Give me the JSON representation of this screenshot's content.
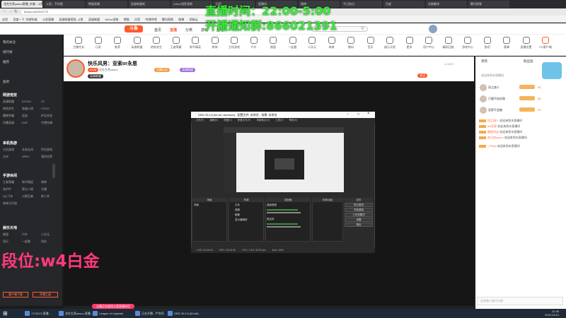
{
  "browser": {
    "tabs": [
      "沈先生养yasuo直播_外服 - 斗鱼直播",
      "斗鱼，手机版",
      "熊猫直播",
      "英雄联盟吧",
      "Arthur领养宠物",
      "抖音",
      "直播间",
      "微博",
      "今日热点",
      "百度",
      "谷歌翻译",
      "腾讯视频"
    ],
    "url": "douyu.com/101772",
    "bookmarks": [
      "应用",
      "百度一下, 你就知道",
      "斗鱼直播",
      "英雄联盟视频_斗鱼",
      "英雄联盟",
      "Arthur宠物",
      "熊猫",
      "抖音",
      "哔哩哔哩",
      "腾讯视频",
      "微博",
      "网易云"
    ]
  },
  "overlay": {
    "stream_time": "直播时间：22:00-5:00",
    "notice_group": "开播通知群:866021391",
    "rank_text": "段位:w4白金"
  },
  "site": {
    "logo": "斗鱼",
    "nav": [
      "首页",
      "直播",
      "分类",
      "游戏",
      "鱼吧"
    ],
    "search_placeholder": "搜索",
    "categories": [
      "主播任务",
      "订阅",
      "推荐",
      "英雄联盟",
      "绝地求生",
      "王者荣耀",
      "和平精英",
      "原神",
      "主机游戏",
      "户外",
      "颜值",
      "一起看",
      "二次元",
      "体育",
      "数码",
      "音乐",
      "娱乐天地",
      "更多",
      "用户中心",
      "精彩回放",
      "游戏中心",
      "鱼吧",
      "赛事",
      "直播设置",
      "PC客户端"
    ]
  },
  "sidebar": {
    "items": [
      "我的关注",
      "排行榜",
      "推荐",
      "鱼吧"
    ],
    "sections": [
      {
        "title": "网游竞技",
        "games": [
          "英雄联盟",
          "DOTA2",
          "CF",
          "绝地求生",
          "穿越火线",
          "CSGO",
          "魔兽争霸",
          "逆战",
          "炉石传说",
          "风暴英雄",
          "DNF",
          "守望先锋"
        ]
      },
      {
        "title": "单机热游",
        "games": [
          "主机游戏",
          "永劫无间",
          "怀旧游戏",
          "方舟",
          "APEX",
          "我的世界"
        ]
      },
      {
        "title": "手游休闲",
        "games": [
          "王者荣耀",
          "和平精英",
          "原神",
          "金铲铲",
          "第五人格",
          "光遇",
          "QQ飞车",
          "火影忍者",
          "狼人杀",
          "球球大作战"
        ]
      },
      {
        "title": "娱乐天地",
        "games": [
          "颜值",
          "户外",
          "二次元",
          "音乐",
          "一起看",
          "科技"
        ]
      }
    ],
    "footer": [
      "客户端下载",
      "开播工具"
    ]
  },
  "room": {
    "title": "快乐风男：亚索or永恩",
    "tags": [
      "LV36",
      "沈先生养yasuo",
      "主播认证",
      "英雄联盟"
    ],
    "follow_label": "关注",
    "follow_count": "1,022人"
  },
  "obs": {
    "title": "OBS 25.0.8 (64-bit, windows) - 配置文件: 未命名 - 场景: 未命名",
    "menu": [
      "文件(F)",
      "编辑(E)",
      "视图(V)",
      "配置文件(P)",
      "场景集合(S)",
      "工具(T)",
      "帮助(H)"
    ],
    "panels": [
      "场景",
      "来源",
      "混音器",
      "转场动画",
      "控件"
    ],
    "scene_item": "场景",
    "sources": [
      "文本",
      "视频",
      "图像",
      "显示器捕获"
    ],
    "mixer": [
      "桌面音频",
      "麦克风"
    ],
    "controls": [
      "停止推流",
      "开始录制",
      "工作室模式",
      "设置",
      "退出"
    ],
    "status": [
      "LIVE: 00:46:24",
      "REC: 00:00:00",
      "CPU: 2.3%, 60.00 fps",
      "kb/s: 2952"
    ]
  },
  "right_panel": {
    "tabs": [
      "贵宾",
      "粉丝团"
    ],
    "ranking": [
      {
        "name": "风之旅人",
        "level": "40"
      },
      {
        "name": "只要不挂机我",
        "level": "38"
      },
      {
        "name": "亚索不会被",
        "level": "33"
      }
    ],
    "chat": [
      {
        "user": "风之旅人",
        "text": "欢迎来到本直播间"
      },
      {
        "user": "w4亚索",
        "text": "欢迎来到本直播间"
      },
      {
        "user": "晨星的宝",
        "text": "欢迎来到本直播间"
      },
      {
        "user": "欢乐的yasuo",
        "text": "欢迎来到本直播间"
      },
      {
        "user": "_Pillow",
        "text": "欢迎来到本直播间"
      }
    ],
    "welcome": "欢迎来到本直播间",
    "input_placeholder": "这里输入聊天内容"
  },
  "gift_bar": "主播正在使用斗鱼直播伴侣",
  "taskbar": {
    "items": [
      "17:06:23 直播...",
      "沈先生养yasuo 直播...",
      "League of Legends",
      "正在开播 - 严世间",
      "OBS 25.0.8 (64-bit)..."
    ],
    "time": "22:46",
    "date": "2021/12/14"
  },
  "colors": {
    "accent": "#ff5a2c",
    "overlay_green": "#3bea3b",
    "rank_pink": "#ff3a7a"
  }
}
